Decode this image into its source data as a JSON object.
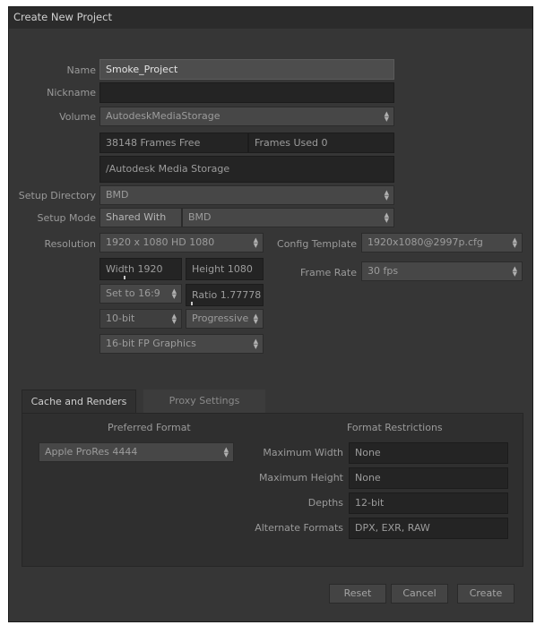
{
  "window": {
    "title": "Create New Project"
  },
  "form": {
    "name_label": "Name",
    "name_value": "Smoke_Project",
    "nickname_label": "Nickname",
    "nickname_value": "",
    "volume_label": "Volume",
    "volume_value": "AutodeskMediaStorage",
    "frames_free": "38148 Frames Free",
    "frames_used": "Frames Used 0",
    "storage_path": "/Autodesk Media Storage",
    "setup_directory_label": "Setup Directory",
    "setup_directory_value": "BMD",
    "setup_mode_label": "Setup Mode",
    "setup_mode_value": "Shared With",
    "setup_mode_target": "BMD",
    "resolution_label": "Resolution",
    "resolution_value": "1920 x 1080 HD 1080",
    "width": "Width 1920",
    "height": "Height 1080",
    "aspect": "Set to 16:9",
    "ratio": "Ratio 1.77778",
    "bit_depth": "10-bit",
    "scan_mode": "Progressive",
    "graphics": "16-bit FP Graphics",
    "config_template_label": "Config Template",
    "config_template_value": "1920x1080@2997p.cfg",
    "frame_rate_label": "Frame Rate",
    "frame_rate_value": "30 fps"
  },
  "tabs": [
    {
      "label": "Cache and Renders",
      "active": true
    },
    {
      "label": "Proxy Settings",
      "active": false
    }
  ],
  "cache": {
    "preferred_format_title": "Preferred Format",
    "preferred_format_value": "Apple ProRes 4444",
    "restrictions_title": "Format Restrictions",
    "max_width_label": "Maximum Width",
    "max_width_value": "None",
    "max_height_label": "Maximum Height",
    "max_height_value": "None",
    "depths_label": "Depths",
    "depths_value": "12-bit",
    "alternate_formats_label": "Alternate Formats",
    "alternate_formats_value": "DPX, EXR, RAW"
  },
  "buttons": {
    "reset": "Reset",
    "cancel": "Cancel",
    "create": "Create"
  }
}
